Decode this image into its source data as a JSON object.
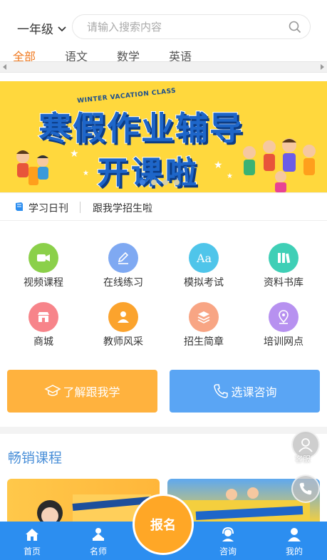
{
  "header": {
    "grade": "一年级",
    "search_placeholder": "请输入搜索内容"
  },
  "tabs": [
    {
      "label": "全部",
      "active": true
    },
    {
      "label": "语文",
      "active": false
    },
    {
      "label": "数学",
      "active": false
    },
    {
      "label": "英语",
      "active": false
    }
  ],
  "banner": {
    "subtitle": "WINTER VACATION CLASS",
    "title": "寒假作业辅导",
    "subtitle2": "开课啦",
    "slide_count": 4,
    "active_slide": 1
  },
  "news": {
    "label": "学习日刊",
    "text": "跟我学招生啦"
  },
  "grid": [
    {
      "label": "视频课程",
      "icon": "video-icon",
      "color": "#8bd04a"
    },
    {
      "label": "在线练习",
      "icon": "pencil-icon",
      "color": "#7fa9f2"
    },
    {
      "label": "模拟考试",
      "icon": "aa-font-icon",
      "color": "#4fc5ea"
    },
    {
      "label": "资料书库",
      "icon": "books-icon",
      "color": "#3fcfb6"
    },
    {
      "label": "商城",
      "icon": "store-icon",
      "color": "#f7848a"
    },
    {
      "label": "教师风采",
      "icon": "teacher-icon",
      "color": "#fba32d"
    },
    {
      "label": "招生简章",
      "icon": "brochure-icon",
      "color": "#f8a584"
    },
    {
      "label": "培训网点",
      "icon": "location-icon",
      "color": "#b791f0"
    }
  ],
  "actions": {
    "learn_more": "了解跟我学",
    "consult": "选课咨询"
  },
  "section": {
    "title": "畅销课程"
  },
  "floating": {
    "service_label": "客服"
  },
  "nav": {
    "home": "首页",
    "teacher": "名师",
    "signup": "报名",
    "consult": "咨询",
    "mine": "我的"
  }
}
